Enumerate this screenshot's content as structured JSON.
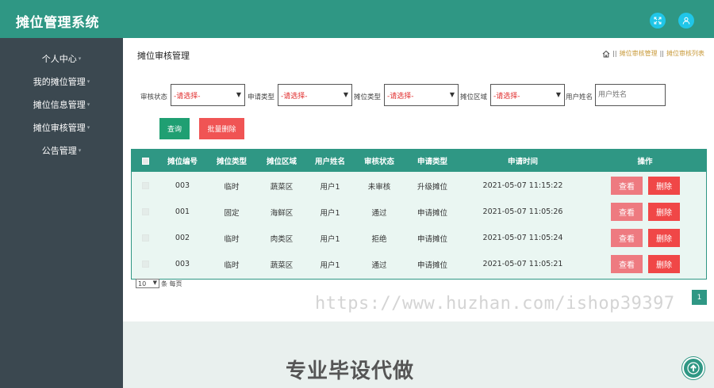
{
  "header": {
    "title": "摊位管理系统",
    "fullscreen_icon": "expand-icon",
    "user_icon": "user-icon"
  },
  "sidebar": {
    "items": [
      {
        "label": "个人中心"
      },
      {
        "label": "我的摊位管理"
      },
      {
        "label": "摊位信息管理"
      },
      {
        "label": "摊位审核管理"
      },
      {
        "label": "公告管理"
      }
    ],
    "caret": "▾"
  },
  "page": {
    "title": "摊位审核管理",
    "breadcrumb": [
      "摊位审核管理",
      "摊位审核列表"
    ],
    "breadcrumb_sep": "||"
  },
  "filters": {
    "review_status": {
      "label": "审核状态",
      "value": "-请选择-"
    },
    "apply_type": {
      "label": "申请类型",
      "value": "-请选择-"
    },
    "stall_type": {
      "label": "摊位类型",
      "value": "-请选择-"
    },
    "stall_area": {
      "label": "摊位区域",
      "value": "-请选择-"
    },
    "user_name": {
      "label": "用户姓名",
      "placeholder": "用户姓名"
    }
  },
  "actions": {
    "query": "查询",
    "batch_delete": "批量删除"
  },
  "table": {
    "headers": [
      "摊位编号",
      "摊位类型",
      "摊位区域",
      "用户姓名",
      "审核状态",
      "申请类型",
      "申请时间",
      "操作"
    ],
    "rows": [
      {
        "no": "003",
        "type": "临时",
        "area": "蔬菜区",
        "user": "用户1",
        "status": "未审核",
        "apply": "升级摊位",
        "time": "2021-05-07 11:15:22"
      },
      {
        "no": "001",
        "type": "固定",
        "area": "海鲜区",
        "user": "用户1",
        "status": "通过",
        "apply": "申请摊位",
        "time": "2021-05-07 11:05:26"
      },
      {
        "no": "002",
        "type": "临时",
        "area": "肉类区",
        "user": "用户1",
        "status": "拒绝",
        "apply": "申请摊位",
        "time": "2021-05-07 11:05:24"
      },
      {
        "no": "003",
        "type": "临时",
        "area": "蔬菜区",
        "user": "用户1",
        "status": "通过",
        "apply": "申请摊位",
        "time": "2021-05-07 11:05:21"
      }
    ],
    "view_label": "查看",
    "delete_label": "删除"
  },
  "pagination": {
    "page_size": "10",
    "page_size_suffix": "条 每页",
    "current_page": "1"
  },
  "watermark": "https://www.huzhan.com/ishop39397",
  "footer": {
    "text": "专业毕设代做"
  },
  "colors": {
    "primary": "#2f9784",
    "sidebar": "#3b4850",
    "danger": "#f04747",
    "view": "#ee7a80"
  }
}
